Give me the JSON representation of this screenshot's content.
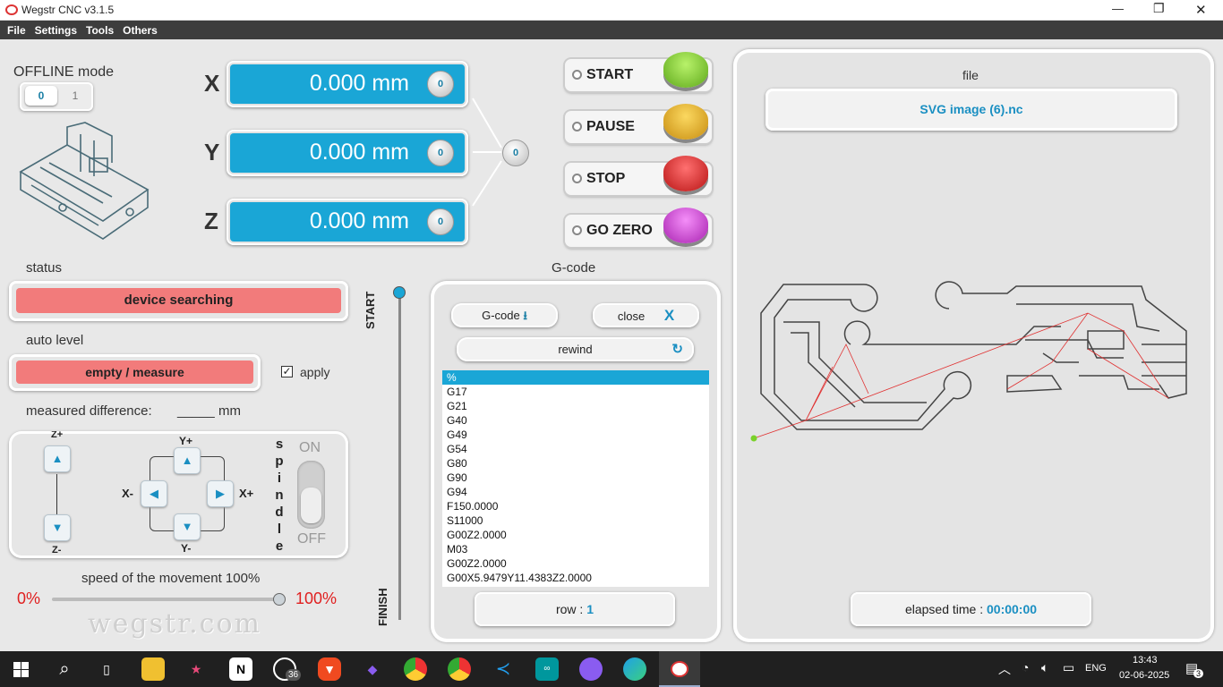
{
  "window": {
    "title": "Wegstr CNC  v3.1.5",
    "minimize": "—",
    "maximize": "❐",
    "close": "✕"
  },
  "menu": [
    "File",
    "Settings",
    "Tools",
    "Others"
  ],
  "offline": {
    "label": "OFFLINE mode",
    "toggle_on": "0",
    "toggle_off": "1"
  },
  "axes": [
    {
      "letter": "X",
      "value": "0.000 mm"
    },
    {
      "letter": "Y",
      "value": "0.000 mm"
    },
    {
      "letter": "Z",
      "value": "0.000 mm"
    }
  ],
  "zero_label": "0",
  "controls": [
    {
      "label": "START",
      "color": "#7ad12a"
    },
    {
      "label": "PAUSE",
      "color": "#e8b020"
    },
    {
      "label": "STOP",
      "color": "#e02a2a"
    },
    {
      "label": "GO ZERO",
      "color": "#d03ad8"
    }
  ],
  "status": {
    "label": "status",
    "value": "device searching"
  },
  "autolevel": {
    "label": "auto level",
    "value": "empty / measure",
    "apply": "apply",
    "apply_checked": true
  },
  "measured": {
    "label": "measured difference:",
    "blank": "_____",
    "unit": "mm"
  },
  "jog": {
    "zplus": "Z+",
    "zminus": "Z-",
    "yplus": "Y+",
    "yminus": "Y-",
    "xminus": "X-",
    "xplus": "X+",
    "spindle": [
      "s",
      "p",
      "i",
      "n",
      "d",
      "l",
      "e"
    ],
    "on": "ON",
    "off": "OFF"
  },
  "speed": {
    "label": "speed of the movement 100%",
    "min": "0%",
    "max": "100%",
    "value": 1.0
  },
  "watermark": "wegstr.com",
  "progress": {
    "start": "START",
    "finish": "FINISH"
  },
  "gcode": {
    "title": "G-code",
    "load": "G-code",
    "close": "close",
    "rewind": "rewind",
    "lines": [
      "%",
      "G17",
      "G21",
      "G40",
      "G49",
      "G54",
      "G80",
      "G90",
      "G94",
      "F150.0000",
      "S11000",
      "G00Z2.0000",
      "M03",
      "G00Z2.0000",
      "G00X5.9479Y11.4383Z2.0000"
    ],
    "row_label": "row :",
    "row_value": "1"
  },
  "file": {
    "label": "file",
    "name": "SVG image (6).nc",
    "elapsed_label": "elapsed time :",
    "elapsed_value": "00:00:00"
  },
  "taskbar": {
    "time": "13:43",
    "date": "02-06-2025",
    "lang": "ENG",
    "whatsapp_badge": "36",
    "notif": "3"
  },
  "colors": {
    "accent": "#1aa6d6",
    "status_red": "#f27b7b"
  }
}
